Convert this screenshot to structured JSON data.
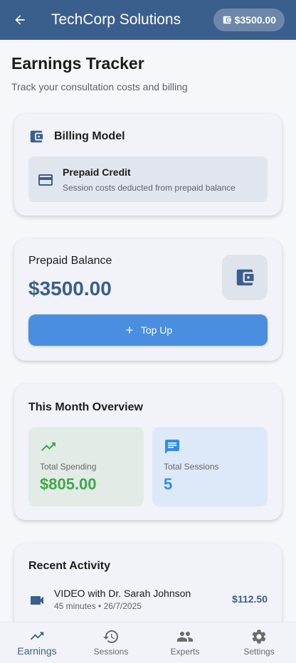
{
  "appbar": {
    "title": "TechCorp Solutions",
    "balance_chip": "$3500.00",
    "back_icon": "arrow-back-icon",
    "wallet_icon": "wallet-icon"
  },
  "page": {
    "title": "Earnings Tracker",
    "subtitle": "Track your consultation costs and billing"
  },
  "billing": {
    "header": "Billing Model",
    "model_title": "Prepaid Credit",
    "model_desc": "Session costs deducted from prepaid balance"
  },
  "balance": {
    "label": "Prepaid Balance",
    "amount": "$3500.00",
    "topup_label": "Top Up"
  },
  "overview": {
    "title": "This Month Overview",
    "spending_label": "Total Spending",
    "spending_value": "$805.00",
    "sessions_label": "Total Sessions",
    "sessions_value": "5"
  },
  "activity": {
    "title": "Recent Activity",
    "items": [
      {
        "title": "VIDEO with Dr. Sarah Johnson",
        "meta": "45 minutes • 26/7/2025",
        "amount": "$112.50"
      }
    ]
  },
  "nav": {
    "items": [
      {
        "label": "Earnings",
        "icon": "trending-up-icon",
        "active": true
      },
      {
        "label": "Sessions",
        "icon": "history-icon",
        "active": false
      },
      {
        "label": "Experts",
        "icon": "people-icon",
        "active": false
      },
      {
        "label": "Settings",
        "icon": "gear-icon",
        "active": false
      }
    ]
  },
  "colors": {
    "primary": "#3b5f8c",
    "accent_blue": "#4a8ee0",
    "green": "#3fa84a",
    "session_blue": "#2f8ee6"
  }
}
